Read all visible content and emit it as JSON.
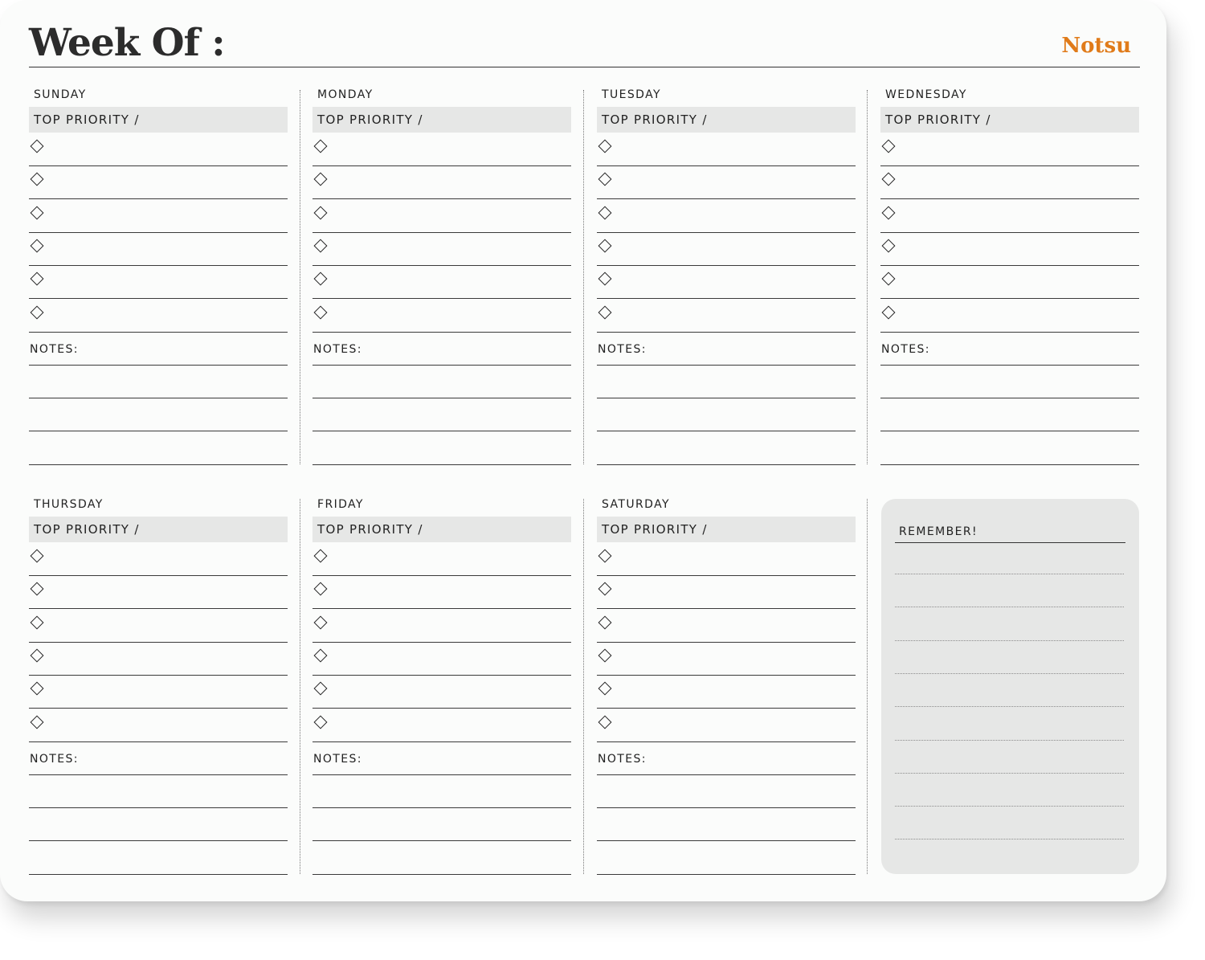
{
  "header": {
    "title": "Week Of :",
    "brand": "Notsu"
  },
  "labels": {
    "priority": "TOP PRIORITY /",
    "notes": "NOTES:"
  },
  "days": [
    {
      "name": "SUNDAY"
    },
    {
      "name": "MONDAY"
    },
    {
      "name": "TUESDAY"
    },
    {
      "name": "WEDNESDAY"
    },
    {
      "name": "THURSDAY"
    },
    {
      "name": "FRIDAY"
    },
    {
      "name": "SATURDAY"
    }
  ],
  "remember": {
    "label": "REMEMBER!"
  },
  "colors": {
    "brand": "#e07b1a",
    "panel_gray": "#e6e7e6",
    "ink": "#222222"
  }
}
